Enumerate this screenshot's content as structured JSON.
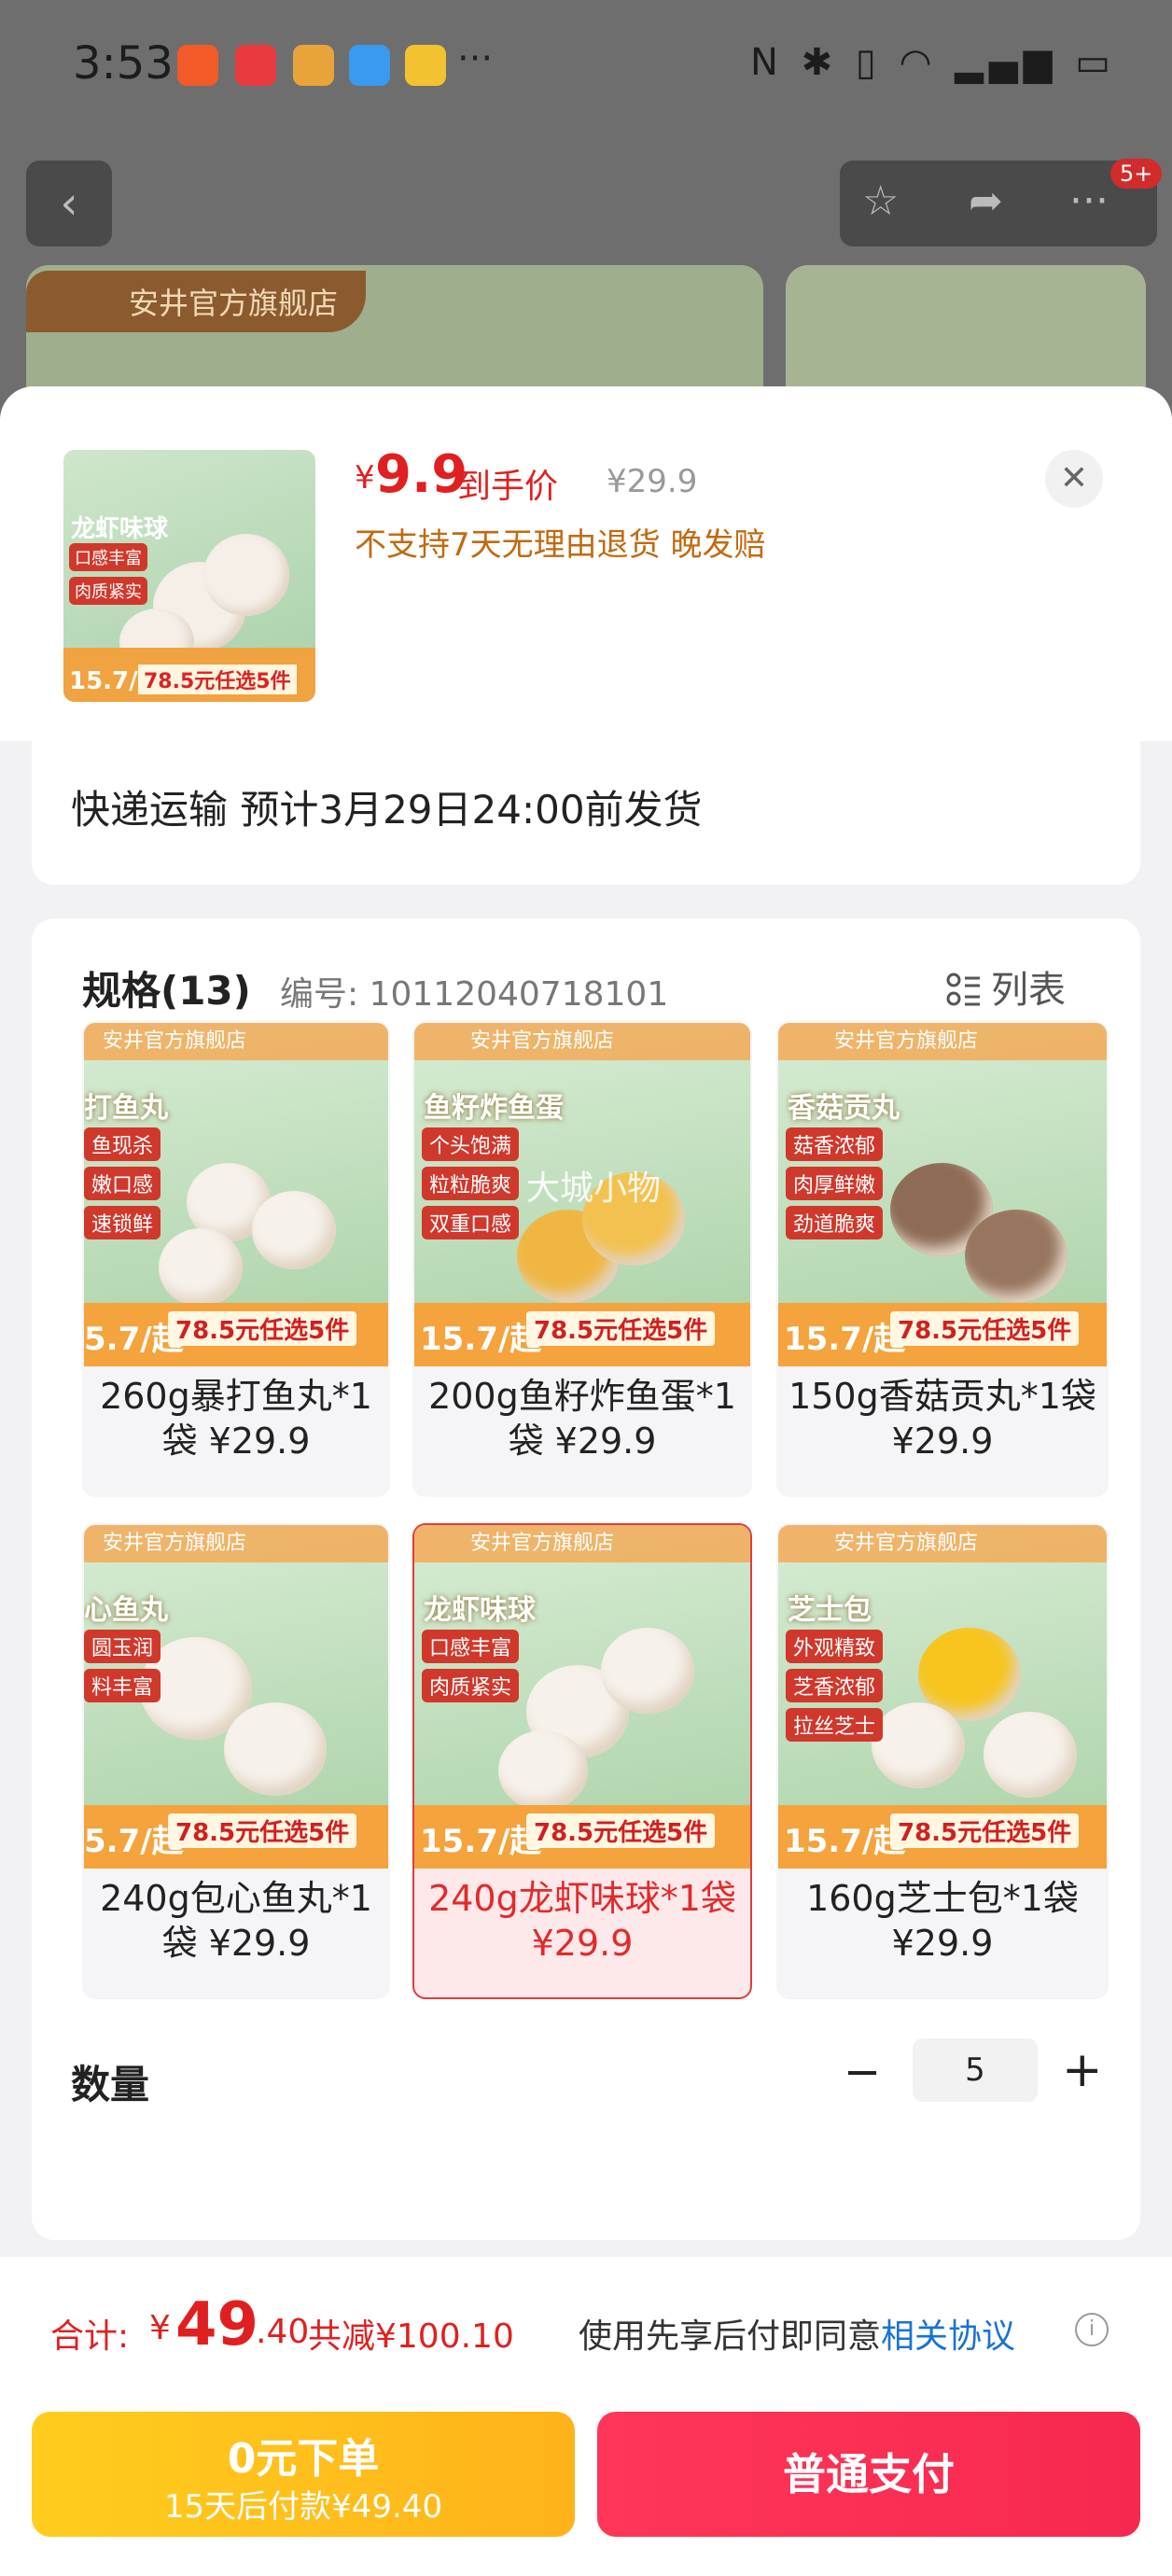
{
  "status_bar": {
    "time": "3:53",
    "more": "···"
  },
  "background_page": {
    "store_name": "安井官方旗舰店",
    "badge": "5+"
  },
  "header": {
    "price_symbol": "¥",
    "price": "9.9",
    "price_label": "到手价",
    "original_price": "¥29.9",
    "note": "不支持7天无理由退货  晚发赔",
    "thumb": {
      "name": "龙虾味球",
      "tag1": "口感丰富",
      "tag2": "肉质紧实",
      "badge": "15.7/起",
      "offer": "78.5元任选5件"
    }
  },
  "shipping": {
    "text": "快递运输 预计3月29日24:00前发货"
  },
  "spec": {
    "title": "规格(13)",
    "code": "编号: 10112040718101",
    "list_label": "列表",
    "brand": "安井官方旗舰店",
    "watermark": "大城小物",
    "items": [
      {
        "name": "打鱼丸",
        "tags": [
          "鱼现杀",
          "嫩口感",
          "速锁鲜"
        ],
        "badge": "5.7/起",
        "offer": "78.5元任选5件",
        "caption": "260g暴打鱼丸*1袋 ¥29.9",
        "selected": false
      },
      {
        "name": "鱼籽炸鱼蛋",
        "tags": [
          "个头饱满",
          "粒粒脆爽",
          "双重口感"
        ],
        "badge": "15.7/起",
        "offer": "78.5元任选5件",
        "caption": "200g鱼籽炸鱼蛋*1袋 ¥29.9",
        "selected": false
      },
      {
        "name": "香菇贡丸",
        "tags": [
          "菇香浓郁",
          "肉厚鲜嫩",
          "劲道脆爽"
        ],
        "badge": "15.7/起",
        "offer": "78.5元任选5件",
        "caption": "150g香菇贡丸*1袋 ¥29.9",
        "selected": false
      },
      {
        "name": "心鱼丸",
        "tags": [
          "圆玉润",
          "料丰富"
        ],
        "badge": "5.7/起",
        "offer": "78.5元任选5件",
        "caption": "240g包心鱼丸*1袋 ¥29.9",
        "selected": false
      },
      {
        "name": "龙虾味球",
        "tags": [
          "口感丰富",
          "肉质紧实"
        ],
        "badge": "15.7/起",
        "offer": "78.5元任选5件",
        "caption": "240g龙虾味球*1袋 ¥29.9",
        "selected": true
      },
      {
        "name": "芝士包",
        "tags": [
          "外观精致",
          "芝香浓郁",
          "拉丝芝士"
        ],
        "badge": "15.7/起",
        "offer": "78.5元任选5件",
        "caption": "160g芝士包*1袋 ¥29.9",
        "selected": false
      }
    ]
  },
  "quantity": {
    "label": "数量",
    "minus": "−",
    "value": "5",
    "plus": "+"
  },
  "footer": {
    "total_label": "合计:",
    "total_symbol": "¥",
    "total_int": "49",
    "total_dec": ".40",
    "saving": "共减¥100.10",
    "agree_prefix": "使用先享后付即同意",
    "agree_link": "相关协议",
    "btn_zero_line1": "0元下单",
    "btn_zero_line2": "15天后付款¥49.40",
    "btn_pay": "普通支付"
  },
  "colors": {
    "accent_red": "#e02020",
    "pay_button": "#f7284f",
    "zero_button": "#ffbf1a",
    "link_blue": "#1a73d4"
  }
}
